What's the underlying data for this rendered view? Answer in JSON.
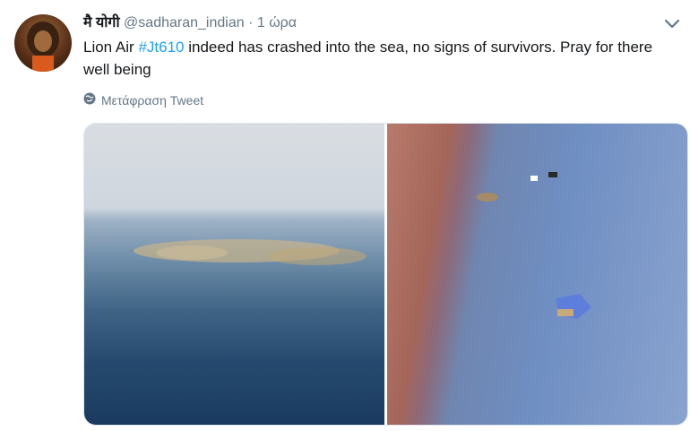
{
  "tweet": {
    "display_name": "मै योगी",
    "handle": "@sadharan_indian",
    "separator": "·",
    "time": "1 ώρα",
    "text_before": "Lion Air ",
    "hashtag": "#Jt610",
    "text_after": " indeed has crashed into the sea, no signs of survivors. Pray for there well being",
    "translate_label": "Μετάφραση Tweet"
  },
  "icons": {
    "caret": "chevron-down-icon",
    "globe": "globe-icon",
    "avatar": "avatar"
  },
  "colors": {
    "link": "#1da1f2",
    "muted": "#657786",
    "text": "#14171a"
  }
}
